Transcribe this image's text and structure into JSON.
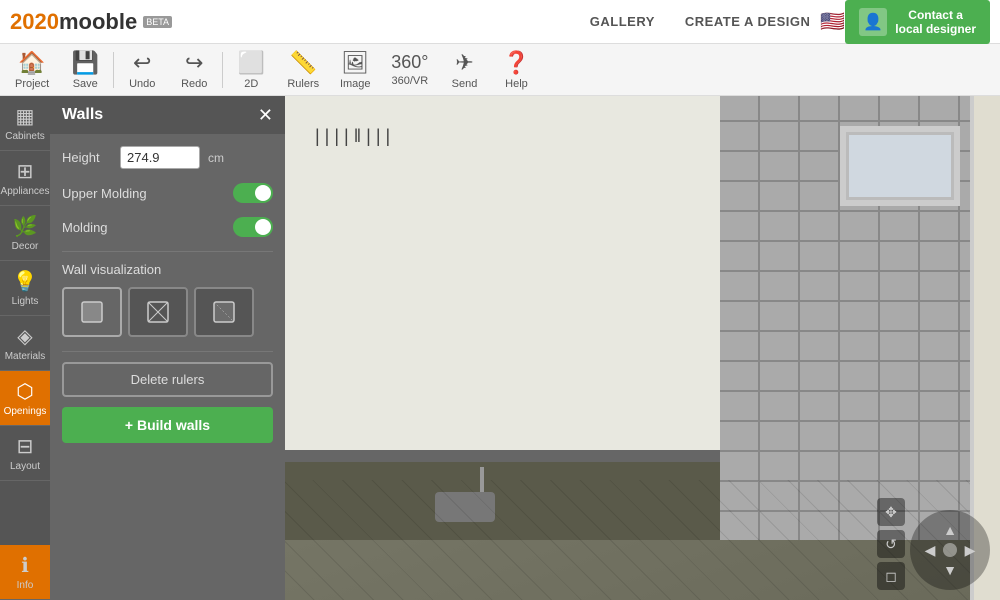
{
  "header": {
    "logo_text": "2020mooble",
    "logo_badge": "BETA",
    "nav_gallery": "GALLERY",
    "nav_create": "CREATE A DESIGN",
    "contact_btn": "Contact a\nlocal designer",
    "flag_emoji": "🇺🇸"
  },
  "toolbar": {
    "buttons": [
      {
        "id": "project",
        "icon": "🏠",
        "label": "Project"
      },
      {
        "id": "save",
        "icon": "💾",
        "label": "Save"
      },
      {
        "id": "undo",
        "icon": "↩",
        "label": "Undo"
      },
      {
        "id": "redo",
        "icon": "↪",
        "label": "Redo"
      },
      {
        "id": "2d",
        "icon": "⬜",
        "label": "2D"
      },
      {
        "id": "rulers",
        "icon": "📏",
        "label": "Rulers"
      },
      {
        "id": "image",
        "icon": "🖼",
        "label": "Image"
      },
      {
        "id": "360vr",
        "icon": "⬡",
        "label": "360/VR"
      },
      {
        "id": "send",
        "icon": "✈",
        "label": "Send"
      },
      {
        "id": "help",
        "icon": "❓",
        "label": "Help"
      }
    ]
  },
  "sidebar": {
    "items": [
      {
        "id": "cabinets",
        "icon": "▦",
        "label": "Cabinets"
      },
      {
        "id": "appliances",
        "icon": "⊞",
        "label": "Appliances"
      },
      {
        "id": "decor",
        "icon": "🌿",
        "label": "Decor",
        "active": false
      },
      {
        "id": "lights",
        "icon": "💡",
        "label": "Lights"
      },
      {
        "id": "materials",
        "icon": "◈",
        "label": "Materials"
      },
      {
        "id": "openings",
        "icon": "⬡",
        "label": "Openings",
        "active": true
      },
      {
        "id": "layout",
        "icon": "⊟",
        "label": "Layout"
      }
    ],
    "info": {
      "icon": "ℹ",
      "label": "Info",
      "active": false
    }
  },
  "panel": {
    "title": "Walls",
    "height_label": "Height",
    "height_value": "274.9",
    "height_unit": "cm",
    "upper_molding_label": "Upper Molding",
    "upper_molding_on": true,
    "molding_label": "Molding",
    "molding_on": true,
    "wall_visualization_label": "Wall visualization",
    "vis_options": [
      {
        "id": "solid",
        "icon": "⬡"
      },
      {
        "id": "wireframe",
        "icon": "⬡"
      },
      {
        "id": "transparent",
        "icon": "⬡"
      }
    ],
    "delete_rulers_btn": "Delete rulers",
    "build_walls_btn": "+ Build walls"
  },
  "canvas": {
    "nav_compass_arrows": [
      "▲",
      "▶",
      "▼",
      "◀"
    ]
  }
}
